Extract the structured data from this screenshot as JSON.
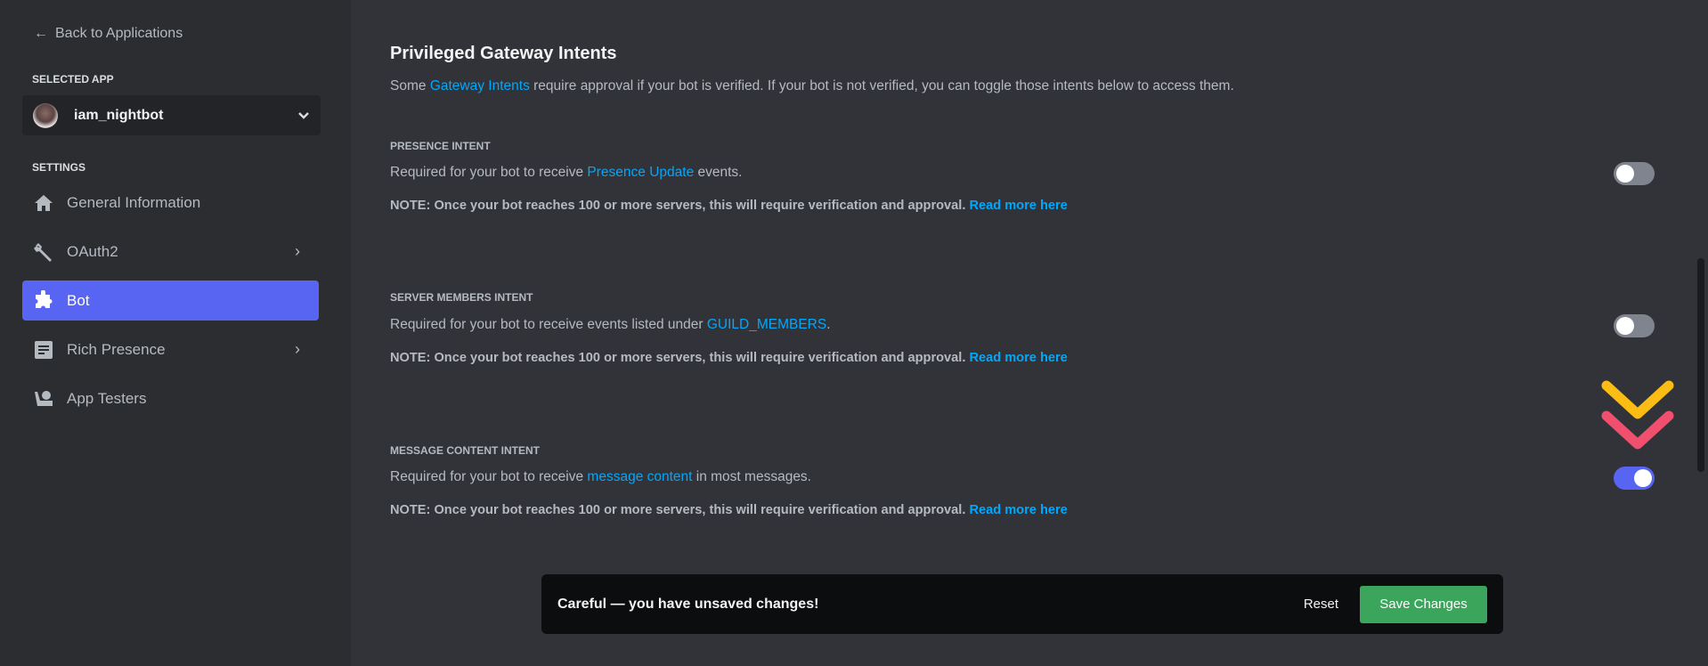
{
  "sidebar": {
    "back_label": "Back to Applications",
    "selected_app_label": "SELECTED APP",
    "app_name": "iam_nightbot",
    "settings_label": "SETTINGS",
    "items": [
      {
        "label": "General Information",
        "icon": "home-icon"
      },
      {
        "label": "OAuth2",
        "icon": "wrench-icon"
      },
      {
        "label": "Bot",
        "icon": "puzzle-icon",
        "active": true
      },
      {
        "label": "Rich Presence",
        "icon": "document-icon"
      },
      {
        "label": "App Testers",
        "icon": "user-icon"
      }
    ]
  },
  "main": {
    "title": "Privileged Gateway Intents",
    "subtitle_pre": "Some ",
    "subtitle_link": "Gateway Intents",
    "subtitle_post": " require approval if your bot is verified. If your bot is not verified, you can toggle those intents below to access them.",
    "intents": [
      {
        "heading": "PRESENCE INTENT",
        "desc_pre": "Required for your bot to receive ",
        "desc_link": "Presence Update",
        "desc_post": " events.",
        "note": "NOTE: Once your bot reaches 100 or more servers, this will require verification and approval.",
        "note_link": "Read more here",
        "enabled": false
      },
      {
        "heading": "SERVER MEMBERS INTENT",
        "desc_pre": "Required for your bot to receive events listed under ",
        "desc_link": "GUILD_MEMBERS",
        "desc_post": ".",
        "note": "NOTE: Once your bot reaches 100 or more servers, this will require verification and approval.",
        "note_link": "Read more here",
        "enabled": false
      },
      {
        "heading": "MESSAGE CONTENT INTENT",
        "desc_pre": "Required for your bot to receive ",
        "desc_link": "message content",
        "desc_post": " in most messages.",
        "note": "NOTE: Once your bot reaches 100 or more servers, this will require verification and approval.",
        "note_link": "Read more here",
        "enabled": true
      }
    ]
  },
  "savebar": {
    "message": "Careful — you have unsaved changes!",
    "reset_label": "Reset",
    "save_label": "Save Changes"
  },
  "colors": {
    "accent": "#5865f2",
    "link": "#00a8fc",
    "save": "#3ba55c",
    "arrow_yellow": "#fbbc13",
    "arrow_red": "#f0506e"
  }
}
